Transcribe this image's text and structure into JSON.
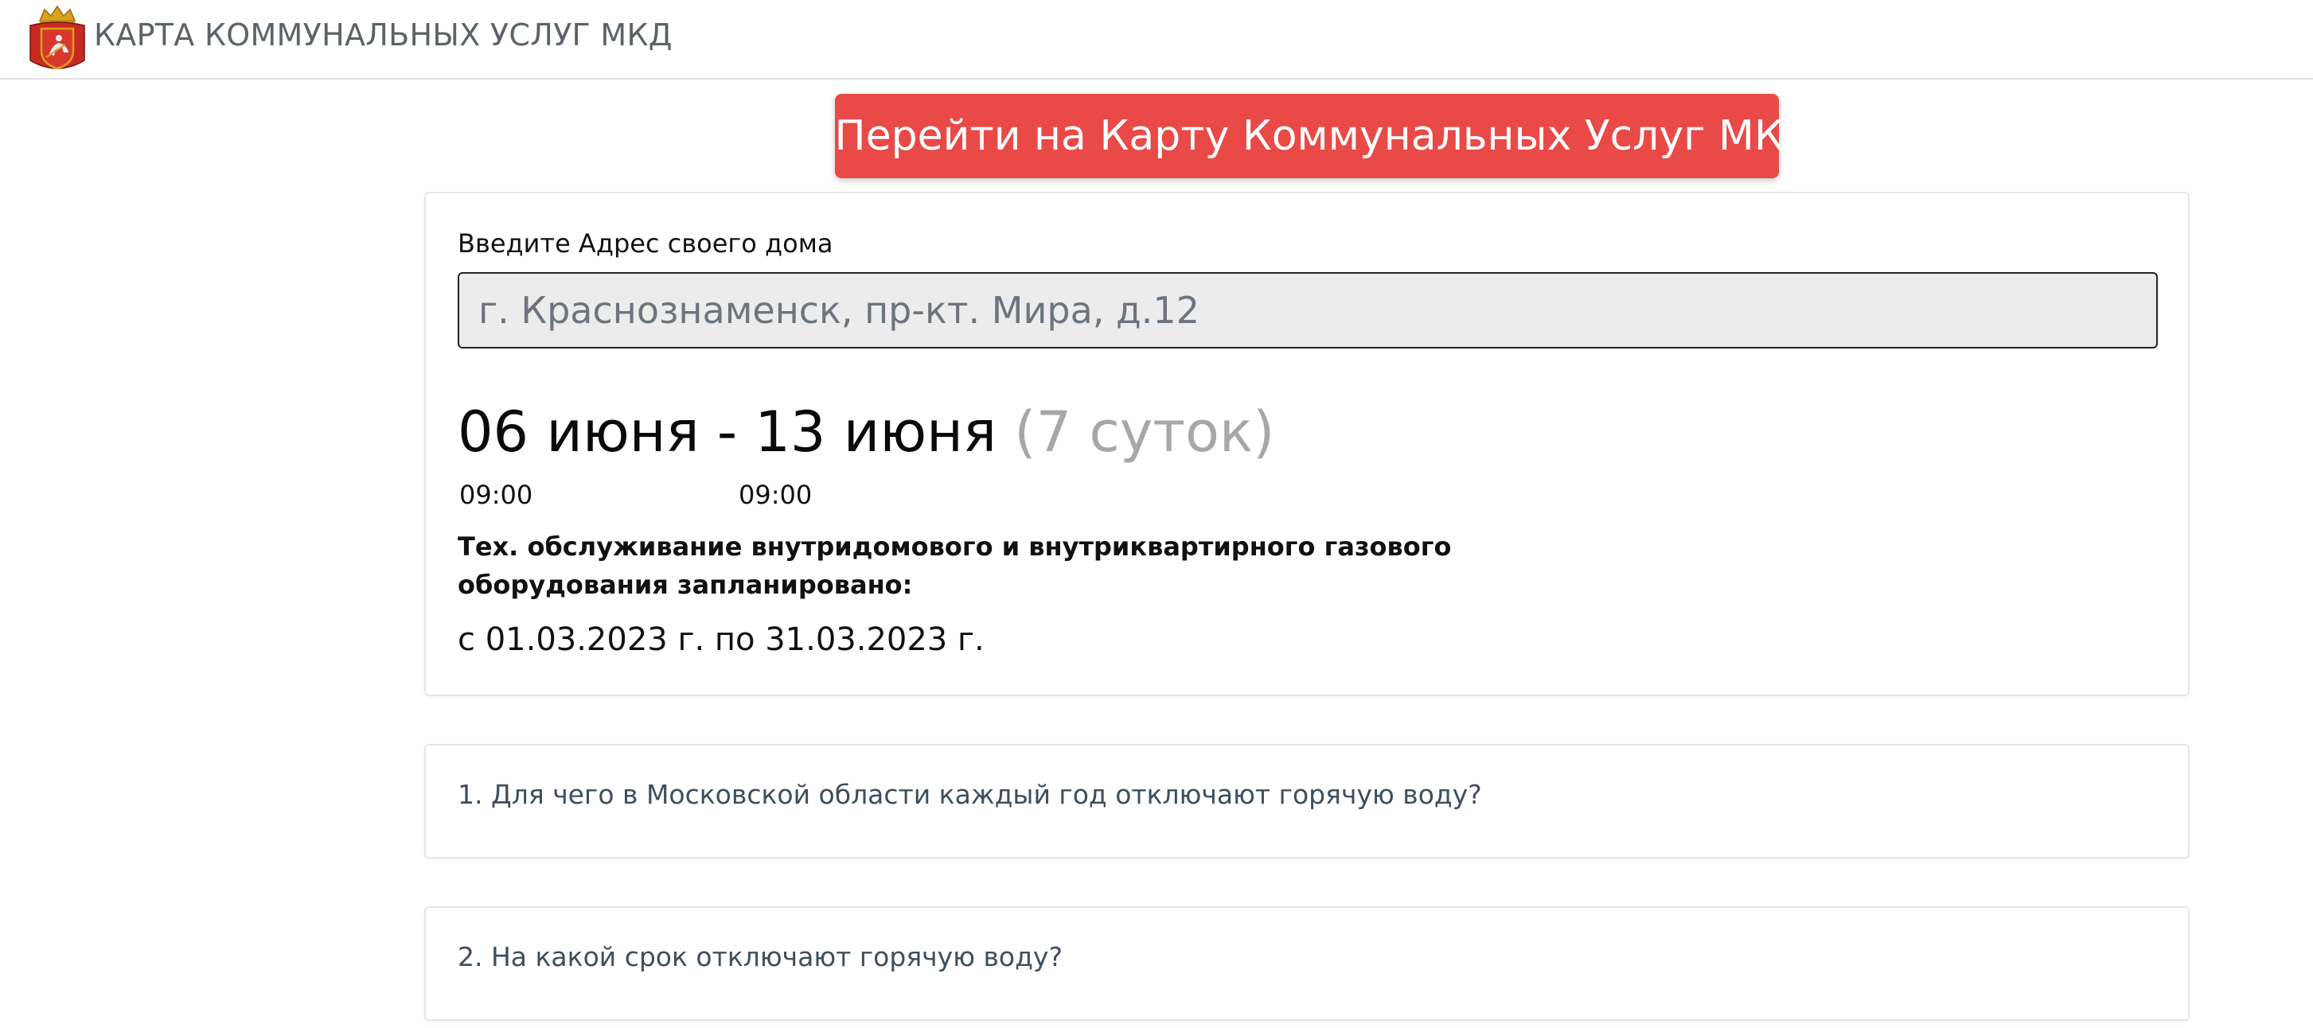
{
  "header": {
    "brand_title": "КАРТА КОММУНАЛЬНЫХ УСЛУГ МКД",
    "emblem_icon": "moscow-oblast-coat-of-arms-icon"
  },
  "cta": {
    "label": "Перейти на Карту Коммунальных Услуг МКД",
    "icon": "map-pin-icon",
    "color": "#e94a47"
  },
  "address": {
    "label": "Введите Адрес своего дома",
    "value": "г. Краснознаменск, пр-кт. Мира, д.12"
  },
  "outage": {
    "start_date": "06 июня",
    "separator": " - ",
    "end_date": "13 июня",
    "duration": "(7 суток)",
    "start_time": "09:00",
    "end_time": "09:00"
  },
  "maintenance": {
    "title": "Тех. обслуживание внутридомового и внутриквартирного газового оборудования запланировано:",
    "period": "с 01.03.2023 г. по 31.03.2023 г."
  },
  "faq": [
    {
      "question": "1. Для чего в Московской области каждый год отключают горячую воду?"
    },
    {
      "question": "2. На какой срок отключают горячую воду?"
    }
  ]
}
